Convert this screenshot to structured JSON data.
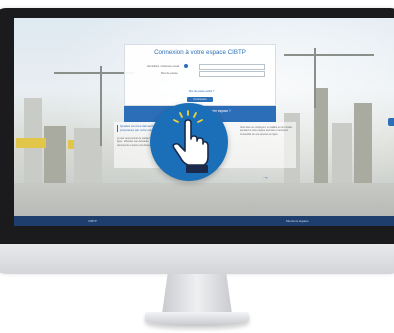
{
  "login": {
    "title": "Connexion à votre espace CIBTP",
    "username_label": "Identifiant / Adresse email",
    "password_label": "Mot de passe",
    "forgot_label": "Mot de passe oublié ?",
    "connect_button": "Connexion"
  },
  "first_connection": {
    "text": "Première connexion à votre espace ?",
    "subtext": "Créer mon compte"
  },
  "info": {
    "question": "Quelles sont les démarches en ligne proposées par votre caisse CIBTP ?",
    "body": "Le site vous permet de réaliser vos démarches en ligne : effectuer une demande, consulter vos documents et suivre vos dossiers.",
    "right_text": "Vous êtes un employeur, un salarié ou un retraité : accédez à votre espace sécurisé et retrouvez l'ensemble de vos services en ligne."
  },
  "footer": {
    "left_label": "CIBTP",
    "right_label": "Mentions légales"
  },
  "colors": {
    "primary_blue": "#2c6fb8",
    "hand_circle": "#1b6fb8",
    "footer_bar": "#1e3f6e"
  }
}
